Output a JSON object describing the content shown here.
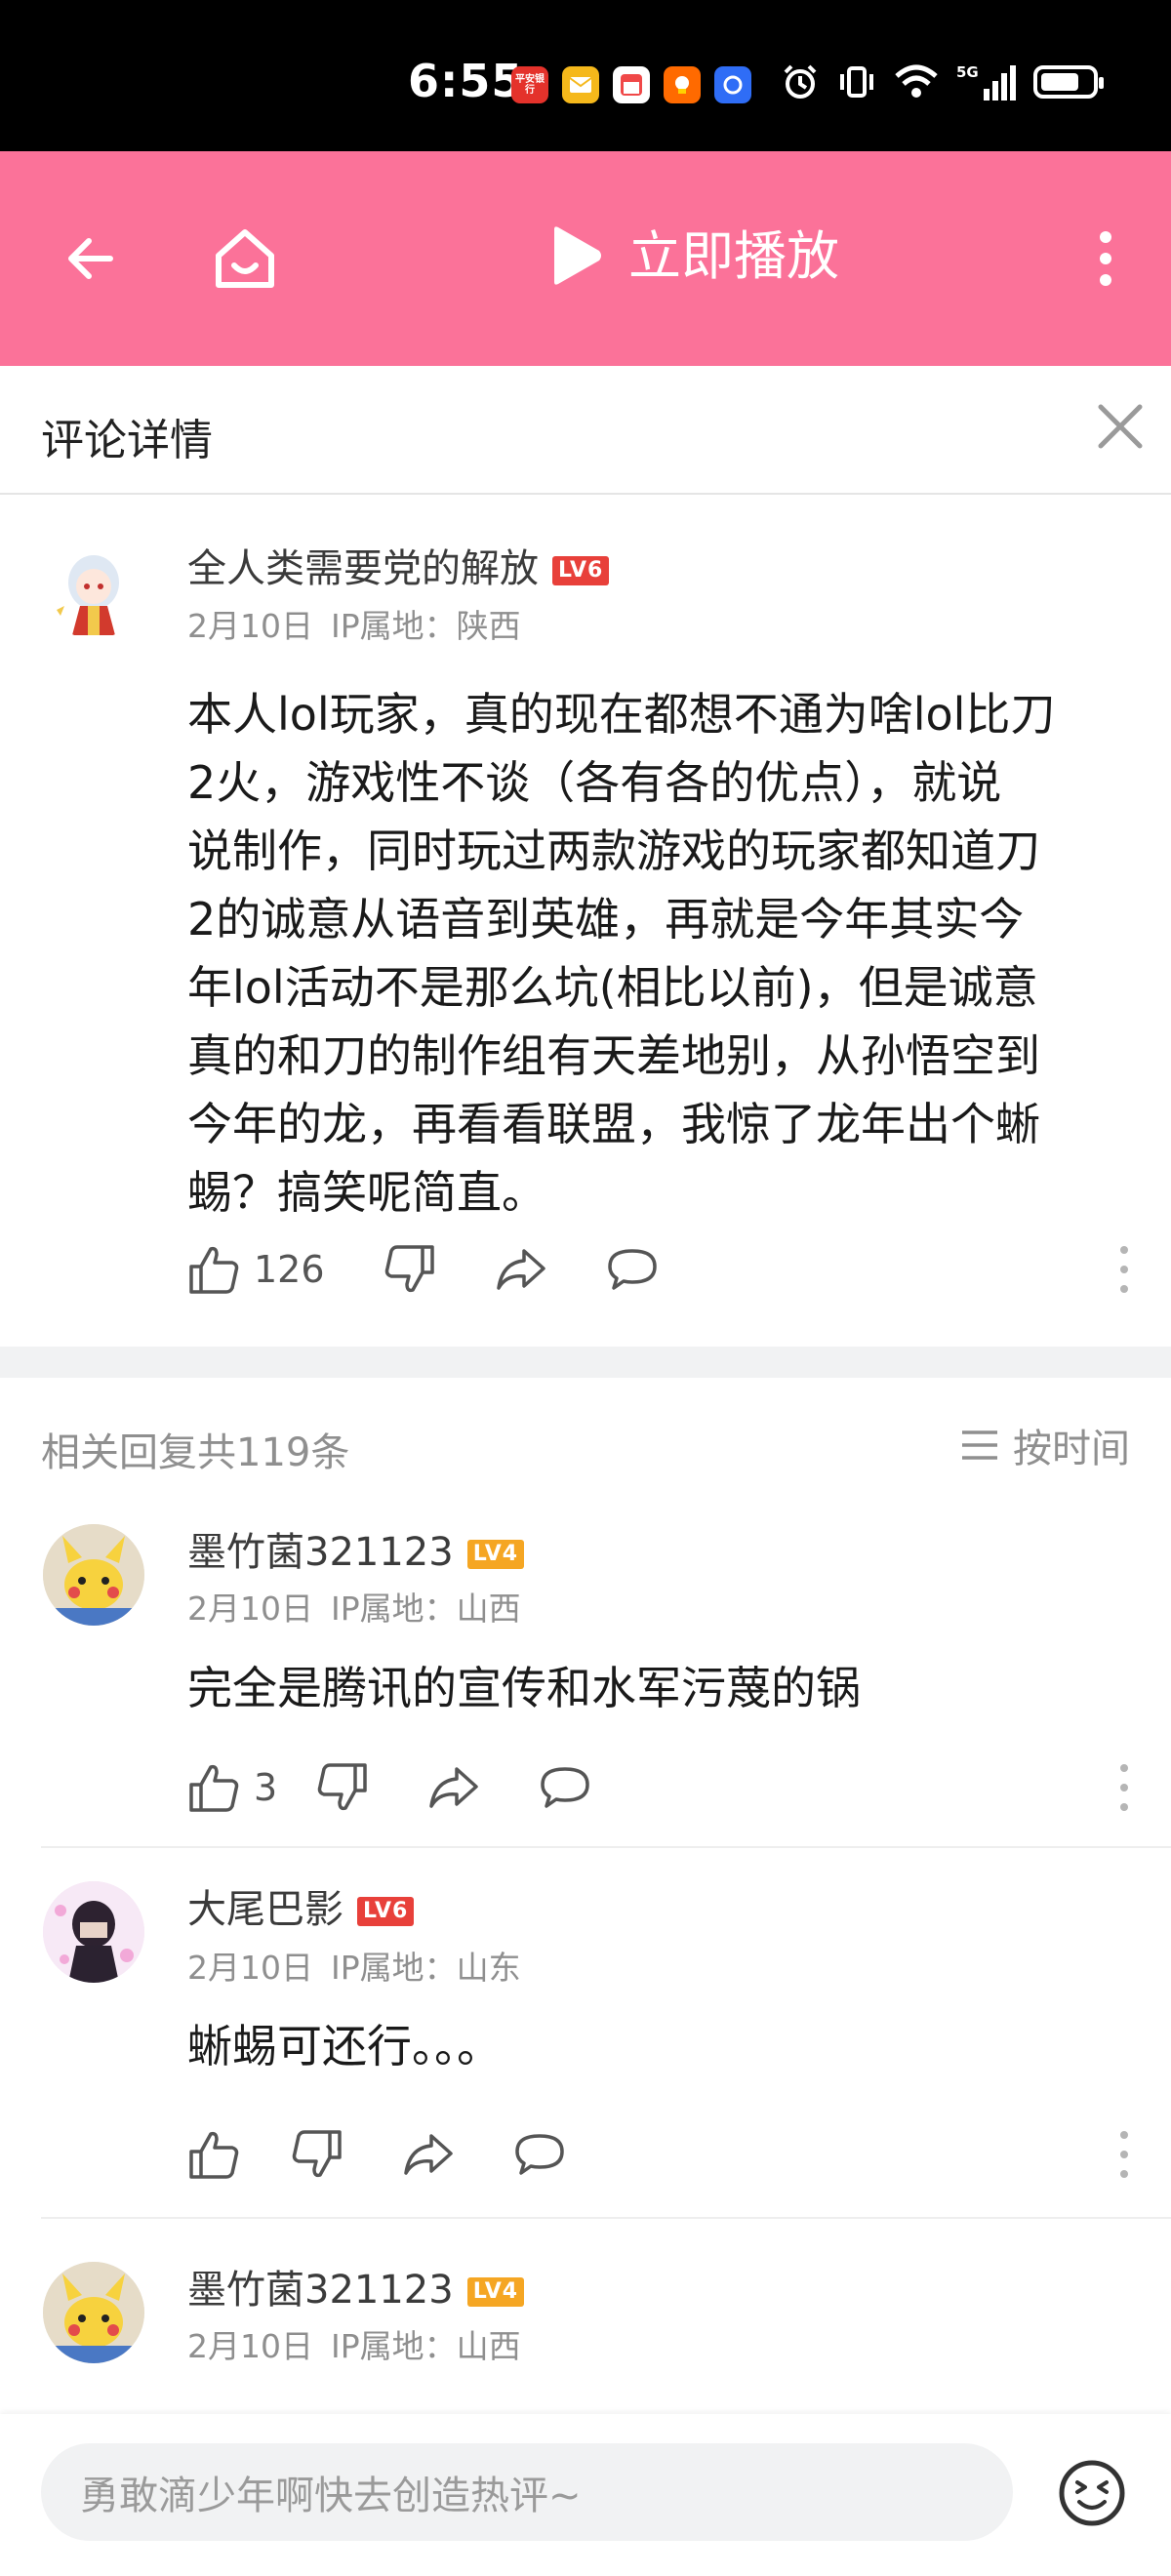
{
  "status_bar": {
    "time": "6:55",
    "apps": [
      "平安银行",
      "邮件",
      "备忘",
      "团购",
      "蓝色应用"
    ],
    "network": "5G"
  },
  "top_bar": {
    "play_label": "立即播放",
    "accent": "#fb7299"
  },
  "detail": {
    "title": "评论详情"
  },
  "main_comment": {
    "username": "全人类需要党的解放",
    "level": "LV6",
    "date": "2月10日",
    "ip": "IP属地：陕西",
    "lines": [
      "本人lol玩家，真的现在都想不通为啥lol比刀",
      "2火，游戏性不谈（各有各的优点），就说",
      "说制作，同时玩过两款游戏的玩家都知道刀",
      "2的诚意从语音到英雄，再就是今年其实今",
      "年lol活动不是那么坑(相比以前)，但是诚意",
      "真的和刀的制作组有天差地别，从孙悟空到",
      "今年的龙，再看看联盟，我惊了龙年出个蜥",
      "蜴？搞笑呢简直。"
    ],
    "likes": "126"
  },
  "replies_header": {
    "count_text": "相关回复共119条",
    "sort_label": "按时间"
  },
  "replies": [
    {
      "username": "墨竹菌321123",
      "level": "LV4",
      "date": "2月10日",
      "ip": "IP属地：山西",
      "text": "完全是腾讯的宣传和水军污蔑的锅",
      "likes": "3"
    },
    {
      "username": "大尾巴影",
      "level": "LV6",
      "date": "2月10日",
      "ip": "IP属地：山东",
      "text": "蜥蜴可还行。。。",
      "likes": ""
    },
    {
      "username": "墨竹菌321123",
      "level": "LV4",
      "date": "2月10日",
      "ip": "IP属地：山西"
    }
  ],
  "bottom_bar": {
    "input_placeholder": "勇敢滴少年啊快去创造热评~"
  },
  "colors": {
    "lv6": "#e8403a",
    "lv4": "#f5a623",
    "muted": "#8f8f8f"
  }
}
